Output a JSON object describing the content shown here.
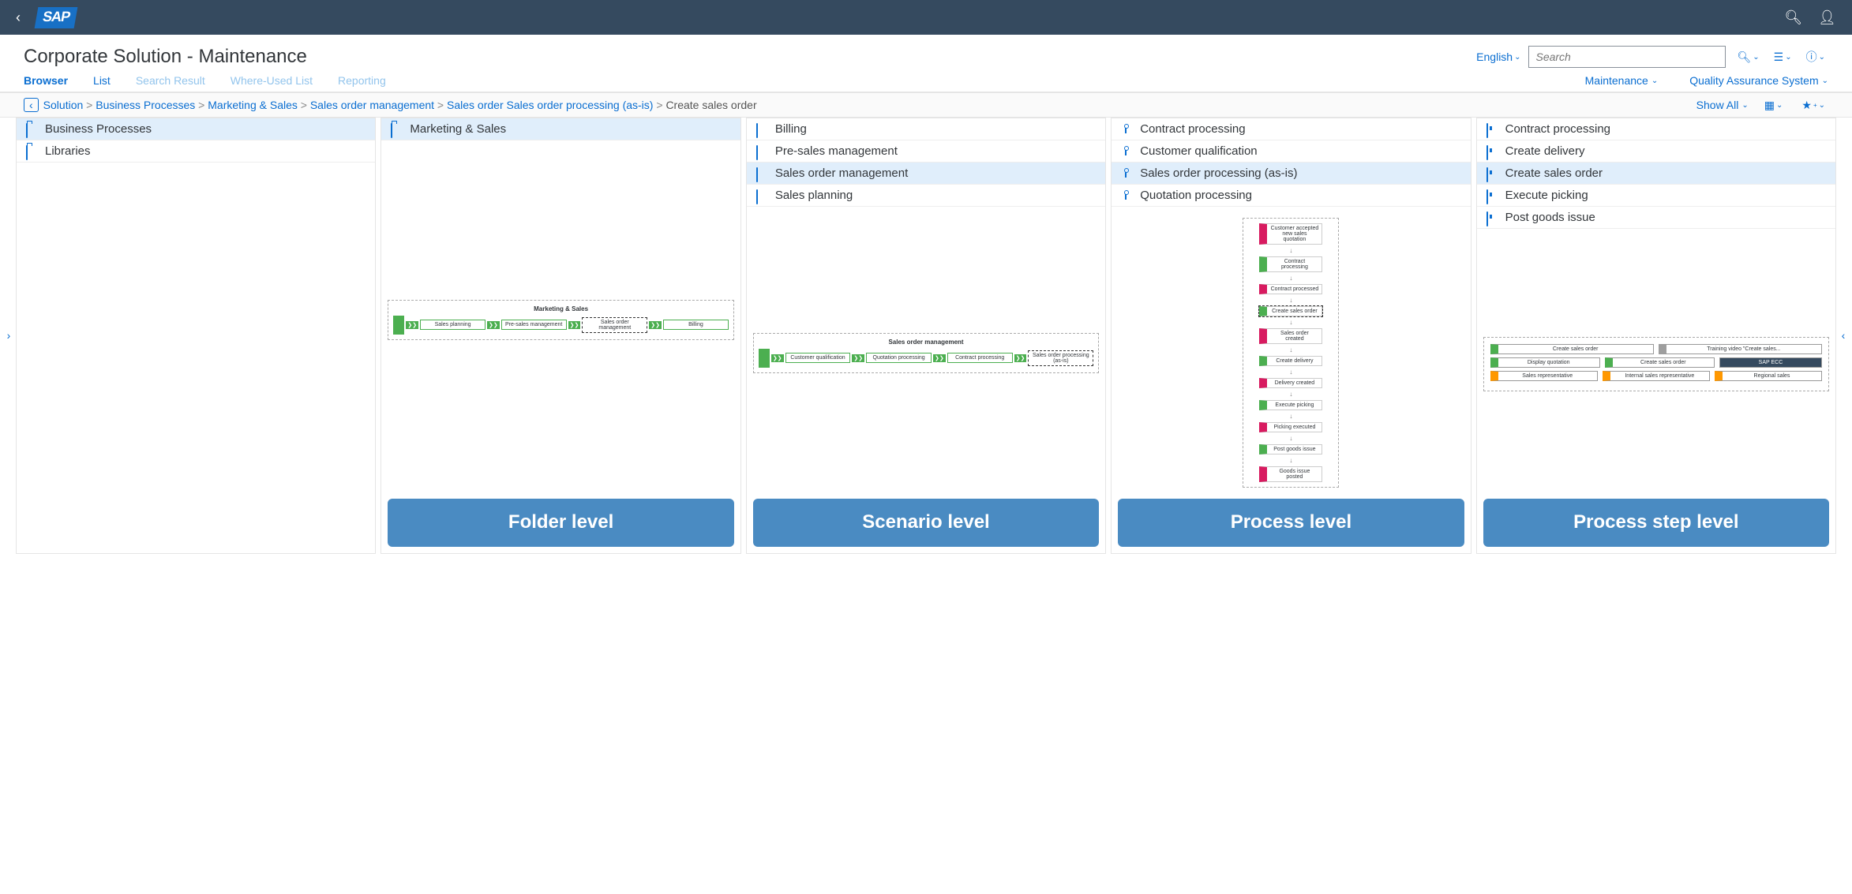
{
  "shell": {
    "logo_text": "SAP"
  },
  "header": {
    "title": "Corporate Solution - Maintenance",
    "language": "English",
    "search_placeholder": "Search"
  },
  "tabs": {
    "left": [
      {
        "label": "Browser",
        "active": true
      },
      {
        "label": "List"
      },
      {
        "label": "Search Result",
        "disabled": true
      },
      {
        "label": "Where-Used List",
        "disabled": true
      },
      {
        "label": "Reporting",
        "disabled": true
      }
    ],
    "right": [
      {
        "label": "Maintenance"
      },
      {
        "label": "Quality Assurance System"
      }
    ]
  },
  "breadcrumb": {
    "items": [
      {
        "label": "Solution",
        "link": true
      },
      {
        "label": "Business Processes",
        "link": true
      },
      {
        "label": "Marketing & Sales",
        "link": true
      },
      {
        "label": "Sales order management",
        "link": true
      },
      {
        "label": "Sales order Sales order processing (as-is)",
        "link": true
      },
      {
        "label": "Create sales order",
        "link": false
      }
    ],
    "show_all": "Show All"
  },
  "columns": {
    "col1": {
      "items": [
        {
          "label": "Business Processes",
          "icon": "folder",
          "selected": true
        },
        {
          "label": "Libraries",
          "icon": "folder"
        }
      ]
    },
    "col2": {
      "items": [
        {
          "label": "Marketing & Sales",
          "icon": "folder",
          "selected": true
        }
      ],
      "diagram": {
        "title": "Marketing & Sales",
        "steps": [
          "Sales planning",
          "Pre-sales management",
          "Sales order management",
          "Billing"
        ],
        "selected_index": 2
      },
      "badge": "Folder level"
    },
    "col3": {
      "items": [
        {
          "label": "Billing",
          "icon": "scenario"
        },
        {
          "label": "Pre-sales management",
          "icon": "scenario"
        },
        {
          "label": "Sales order management",
          "icon": "scenario",
          "selected": true
        },
        {
          "label": "Sales planning",
          "icon": "scenario"
        }
      ],
      "diagram": {
        "title": "Sales order management",
        "steps": [
          "Customer qualification",
          "Quotation processing",
          "Contract processing",
          "Sales order processing (as-is)"
        ],
        "selected_index": 3
      },
      "badge": "Scenario level"
    },
    "col4": {
      "items": [
        {
          "label": "Contract processing",
          "icon": "process"
        },
        {
          "label": "Customer qualification",
          "icon": "process"
        },
        {
          "label": "Sales order processing (as-is)",
          "icon": "process",
          "selected": true
        },
        {
          "label": "Quotation processing",
          "icon": "process"
        }
      ],
      "vflow": [
        {
          "label": "Customer accepted new sales quotation",
          "type": "pink"
        },
        {
          "label": "Contract processing",
          "type": "green"
        },
        {
          "label": "Contract processed",
          "type": "pink"
        },
        {
          "label": "Create sales order",
          "type": "green",
          "selected": true
        },
        {
          "label": "Sales order created",
          "type": "pink"
        },
        {
          "label": "Create delivery",
          "type": "green"
        },
        {
          "label": "Delivery created",
          "type": "pink"
        },
        {
          "label": "Execute picking",
          "type": "green"
        },
        {
          "label": "Picking executed",
          "type": "pink"
        },
        {
          "label": "Post goods issue",
          "type": "green"
        },
        {
          "label": "Goods issue posted",
          "type": "pink"
        }
      ],
      "badge": "Process level"
    },
    "col5": {
      "items": [
        {
          "label": "Contract processing",
          "icon": "step"
        },
        {
          "label": "Create delivery",
          "icon": "step"
        },
        {
          "label": "Create sales order",
          "icon": "step",
          "selected": true
        },
        {
          "label": "Execute picking",
          "icon": "step"
        },
        {
          "label": "Post goods issue",
          "icon": "step"
        }
      ],
      "graph": {
        "row1": [
          {
            "label": "Create sales order",
            "cls": "green"
          },
          {
            "label": "Training video \"Create sales...",
            "cls": "grey"
          }
        ],
        "row2": [
          {
            "label": "Display quotation",
            "cls": "green"
          },
          {
            "label": "Create sales order",
            "cls": "green"
          },
          {
            "label": "SAP ECC",
            "cls": "dark"
          }
        ],
        "row3": [
          {
            "label": "Sales representative",
            "cls": "orange"
          },
          {
            "label": "Internal sales representative",
            "cls": "orange"
          },
          {
            "label": "Regional sales",
            "cls": "orange"
          }
        ]
      },
      "badge": "Process step level"
    }
  }
}
